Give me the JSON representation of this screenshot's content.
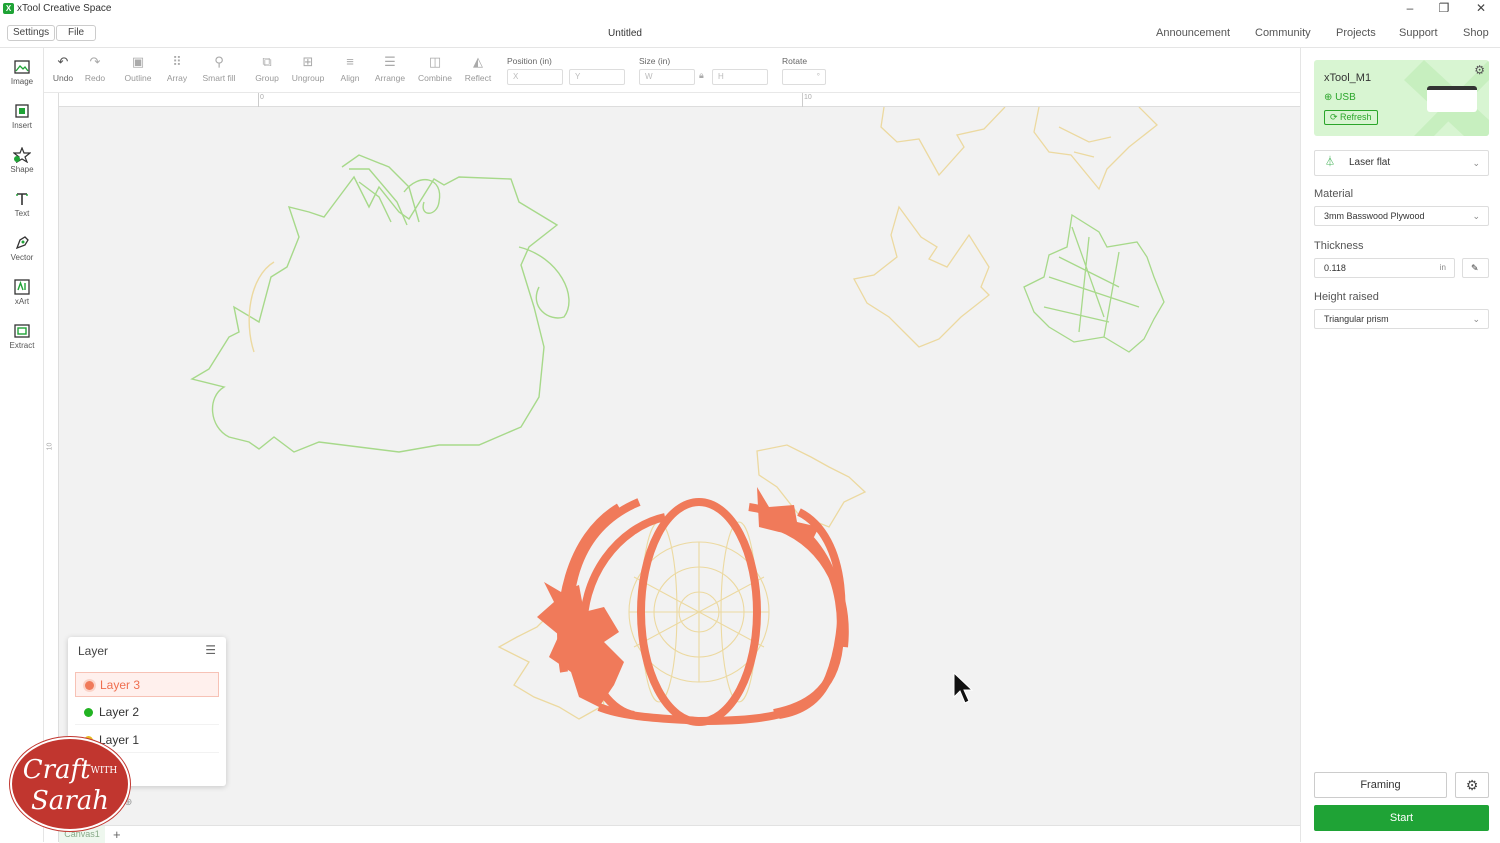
{
  "app": {
    "title": "xTool Creative Space",
    "logo_letter": "X"
  },
  "menu": {
    "settings": "Settings",
    "file": "File"
  },
  "document": {
    "title": "Untitled"
  },
  "nav": [
    "Announcement",
    "Community",
    "Projects",
    "Support",
    "Shop"
  ],
  "toolbar": {
    "tools": [
      "Undo",
      "Redo",
      "Outline",
      "Array",
      "Smart fill",
      "Group",
      "Ungroup",
      "Align",
      "Arrange",
      "Combine",
      "Reflect"
    ],
    "position_label": "Position (in)",
    "size_label": "Size (in)",
    "rotate_label": "Rotate",
    "x_placeholder": "X",
    "y_placeholder": "Y",
    "w_placeholder": "W",
    "h_placeholder": "H",
    "rotate_unit": "°"
  },
  "leftbar": [
    "Image",
    "Insert",
    "Shape",
    "Text",
    "Vector",
    "xArt",
    "Extract"
  ],
  "rulers": {
    "top": [
      "0",
      "10"
    ],
    "left": [
      "10"
    ]
  },
  "layers": {
    "title": "Layer",
    "items": [
      {
        "name": "Layer 3",
        "color": "#f07a5a",
        "selected": true
      },
      {
        "name": "Layer 2",
        "color": "#22b322",
        "selected": false
      },
      {
        "name": "Layer 1",
        "color": "#e8b820",
        "selected": false
      }
    ]
  },
  "canvas_tab": "Canvas1",
  "watermark": {
    "line1": "Craft",
    "with": "WITH",
    "line2": "Sarah"
  },
  "device": {
    "name": "xTool_M1",
    "connection": "USB",
    "refresh": "Refresh"
  },
  "right": {
    "mode": "Laser flat",
    "material_label": "Material",
    "material": "3mm Basswood Plywood",
    "thickness_label": "Thickness",
    "thickness": "0.118",
    "thickness_unit": "in",
    "height_label": "Height raised",
    "height": "Triangular prism",
    "framing": "Framing",
    "start": "Start"
  },
  "colors": {
    "accent": "#1fa336",
    "layer3": "#f07a5a",
    "layer2_line": "#a7d98a",
    "layer1_line": "#ecd9a0"
  }
}
